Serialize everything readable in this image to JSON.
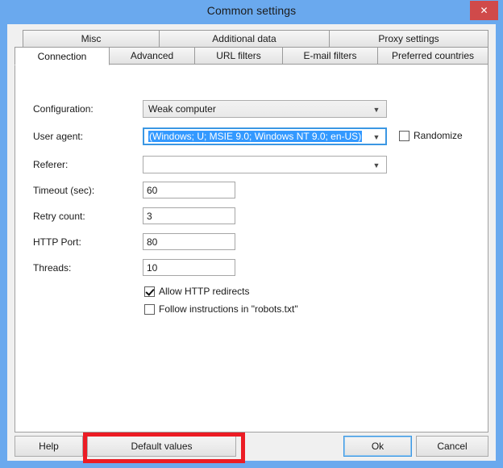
{
  "window": {
    "title": "Common settings",
    "close_label": "✕",
    "frame_color": "#6aa9ee",
    "close_button_color": "#d04a4a"
  },
  "tabs": {
    "top_row": [
      {
        "label": "Misc",
        "active": false
      },
      {
        "label": "Additional data",
        "active": false
      },
      {
        "label": "Proxy settings",
        "active": false
      }
    ],
    "bottom_row": [
      {
        "label": "Connection",
        "active": true
      },
      {
        "label": "Advanced",
        "active": false
      },
      {
        "label": "URL filters",
        "active": false
      },
      {
        "label": "E-mail filters",
        "active": false
      },
      {
        "label": "Preferred countries",
        "active": false
      }
    ]
  },
  "form": {
    "configuration": {
      "label": "Configuration:",
      "value": "Weak computer"
    },
    "user_agent": {
      "label": "User agent:",
      "value": "(Windows; U; MSIE 9.0; Windows NT 9.0; en-US)",
      "selected": true,
      "selection_color": "#3399ff"
    },
    "randomize": {
      "label": "Randomize",
      "checked": false
    },
    "referer": {
      "label": "Referer:",
      "value": ""
    },
    "timeout": {
      "label": "Timeout (sec):",
      "value": "60"
    },
    "retry_count": {
      "label": "Retry count:",
      "value": "3"
    },
    "http_port": {
      "label": "HTTP Port:",
      "value": "80"
    },
    "threads": {
      "label": "Threads:",
      "value": "10"
    },
    "allow_redirects": {
      "label": "Allow HTTP redirects",
      "checked": true
    },
    "follow_robots": {
      "label": "Follow instructions in \"robots.txt\"",
      "checked": false
    }
  },
  "footer": {
    "help": "Help",
    "default_values": "Default values",
    "ok": "Ok",
    "cancel": "Cancel"
  },
  "annotation": {
    "target": "Default values",
    "color": "#ec1c24"
  }
}
